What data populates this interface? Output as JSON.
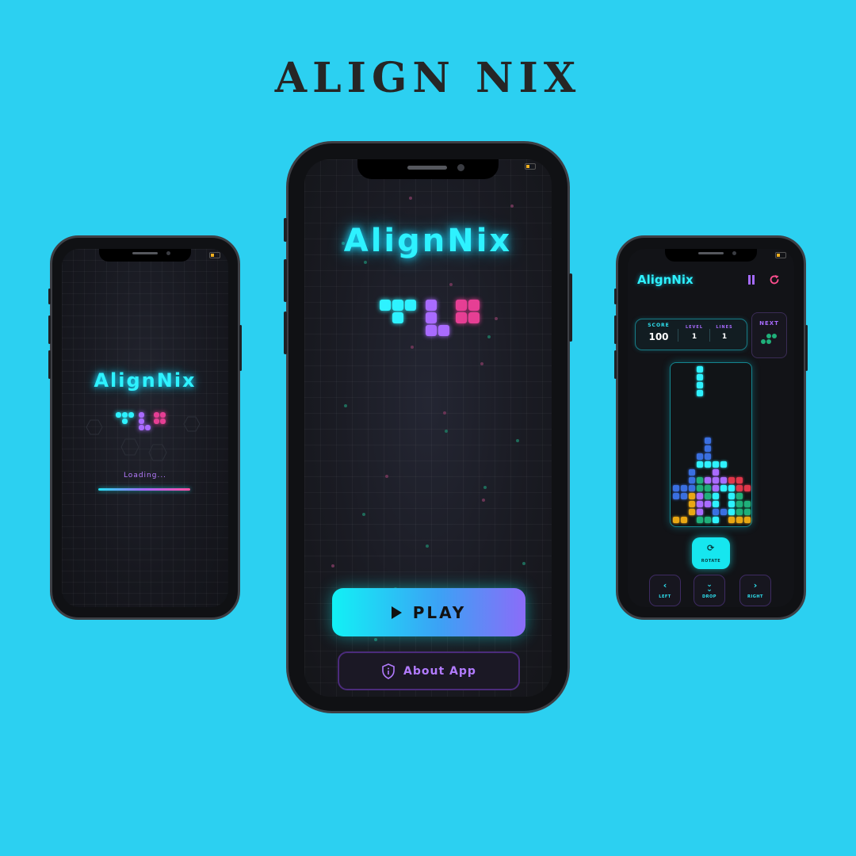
{
  "banner": {
    "title": "ALIGN NIX"
  },
  "colors": {
    "background": "#2cd0f1",
    "neon_cyan": "#2ef2ff",
    "purple": "#a96bff",
    "pink": "#e63f94",
    "green": "#1fb07a",
    "blue": "#3a6fe0",
    "yellow": "#e8a713",
    "red": "#e0364a"
  },
  "loading_screen": {
    "title": "AlignNix",
    "status": "Loading..."
  },
  "home_screen": {
    "title": "AlignNix",
    "play_label": "PLAY",
    "about_label": "About App"
  },
  "game_screen": {
    "title": "AlignNix",
    "stats": {
      "score_label": "SCORE",
      "score": "100",
      "level_label": "LEVEL",
      "level": "1",
      "lines_label": "LINES",
      "lines": "1"
    },
    "next_label": "NEXT",
    "controls": {
      "rotate": "ROTATE",
      "left": "LEFT",
      "drop": "DROP",
      "right": "RIGHT"
    },
    "board": {
      "columns": 10,
      "rows": 20,
      "active_piece": {
        "color": "cyan",
        "cells": [
          [
            3,
            0
          ],
          [
            3,
            1
          ],
          [
            3,
            2
          ],
          [
            3,
            3
          ]
        ]
      },
      "locked_cells": [
        [
          4,
          9,
          "blue"
        ],
        [
          4,
          10,
          "blue"
        ],
        [
          3,
          11,
          "blue"
        ],
        [
          4,
          11,
          "blue"
        ],
        [
          3,
          12,
          "cyan"
        ],
        [
          4,
          12,
          "cyan"
        ],
        [
          5,
          12,
          "cyan"
        ],
        [
          6,
          12,
          "cyan"
        ],
        [
          2,
          13,
          "blue"
        ],
        [
          5,
          13,
          "purple"
        ],
        [
          2,
          14,
          "blue"
        ],
        [
          3,
          14,
          "green"
        ],
        [
          4,
          14,
          "purple"
        ],
        [
          5,
          14,
          "purple"
        ],
        [
          6,
          14,
          "purple"
        ],
        [
          7,
          14,
          "red"
        ],
        [
          8,
          14,
          "red"
        ],
        [
          0,
          15,
          "blue"
        ],
        [
          1,
          15,
          "blue"
        ],
        [
          2,
          15,
          "blue"
        ],
        [
          3,
          15,
          "green"
        ],
        [
          4,
          15,
          "green"
        ],
        [
          5,
          15,
          "purple"
        ],
        [
          6,
          15,
          "cyan"
        ],
        [
          7,
          15,
          "cyan"
        ],
        [
          8,
          15,
          "red"
        ],
        [
          9,
          15,
          "red"
        ],
        [
          0,
          16,
          "blue"
        ],
        [
          1,
          16,
          "blue"
        ],
        [
          2,
          16,
          "yellow"
        ],
        [
          3,
          16,
          "purple"
        ],
        [
          4,
          16,
          "green"
        ],
        [
          5,
          16,
          "cyan"
        ],
        [
          7,
          16,
          "cyan"
        ],
        [
          8,
          16,
          "green"
        ],
        [
          2,
          17,
          "yellow"
        ],
        [
          3,
          17,
          "purple"
        ],
        [
          4,
          17,
          "purple"
        ],
        [
          5,
          17,
          "cyan"
        ],
        [
          7,
          17,
          "cyan"
        ],
        [
          8,
          17,
          "green"
        ],
        [
          9,
          17,
          "green"
        ],
        [
          2,
          18,
          "yellow"
        ],
        [
          3,
          18,
          "purple"
        ],
        [
          5,
          18,
          "blue"
        ],
        [
          6,
          18,
          "blue"
        ],
        [
          7,
          18,
          "cyan"
        ],
        [
          8,
          18,
          "green"
        ],
        [
          9,
          18,
          "green"
        ],
        [
          0,
          19,
          "yellow"
        ],
        [
          1,
          19,
          "yellow"
        ],
        [
          3,
          19,
          "green"
        ],
        [
          4,
          19,
          "green"
        ],
        [
          5,
          19,
          "cyan"
        ],
        [
          7,
          19,
          "yellow"
        ],
        [
          8,
          19,
          "yellow"
        ],
        [
          9,
          19,
          "yellow"
        ]
      ]
    },
    "next_piece": {
      "color": "green",
      "cells": [
        [
          1,
          0
        ],
        [
          2,
          0
        ],
        [
          0,
          1
        ],
        [
          1,
          1
        ]
      ]
    }
  }
}
